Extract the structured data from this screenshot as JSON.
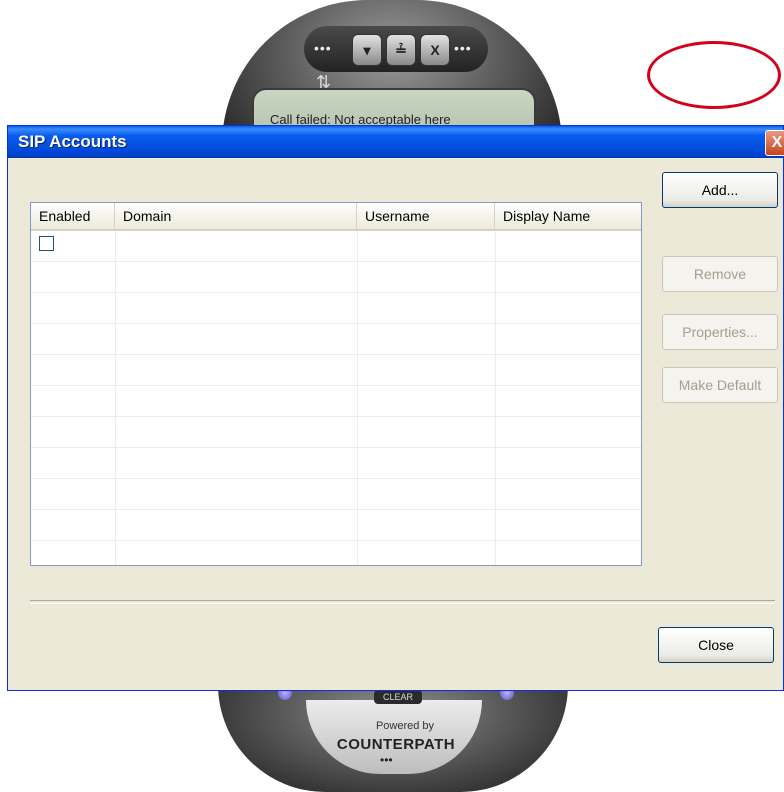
{
  "background_app": {
    "status_text": "Call failed: Not acceptable here",
    "clear_label": "CLEAR",
    "powered_by": "Powered by",
    "brand": "COUNTERPATH",
    "top_buttons": [
      "▾",
      "≟",
      "X"
    ]
  },
  "dialog": {
    "title": "SIP Accounts",
    "close_glyph": "X",
    "table": {
      "columns": [
        "Enabled",
        "Domain",
        "Username",
        "Display Name"
      ],
      "rows": [
        {
          "enabled": false,
          "domain": "",
          "username": "",
          "display_name": ""
        }
      ]
    },
    "buttons": {
      "add": "Add...",
      "remove": "Remove",
      "properties": "Properties...",
      "make_default": "Make Default",
      "close": "Close"
    }
  },
  "colors": {
    "titlebar": "#0a5cf0",
    "dialog_bg": "#ece9d8",
    "annotation_ring": "#d4001c"
  }
}
